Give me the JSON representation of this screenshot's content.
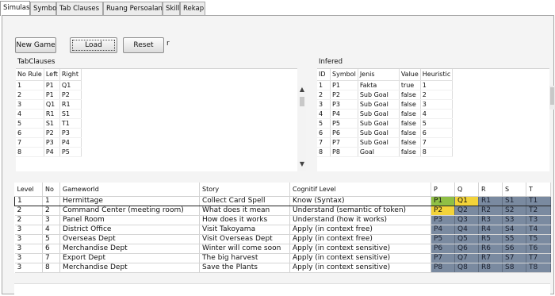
{
  "tabs": [
    {
      "label": "Simulasi",
      "active": true
    },
    {
      "label": "Symbol",
      "active": false
    },
    {
      "label": "Tab Clauses",
      "active": false
    },
    {
      "label": "Ruang Persoalan",
      "active": false
    },
    {
      "label": "Skill",
      "active": false
    },
    {
      "label": "Rekap",
      "active": false
    }
  ],
  "toolbar": {
    "new_game": "New Game",
    "load": "Load",
    "reset": "Reset",
    "stray_text": "r"
  },
  "tab_clauses": {
    "title": "TabClauses",
    "headers": [
      "No Rule",
      "Left",
      "Right"
    ],
    "rows": [
      [
        "1",
        "P1",
        "Q1"
      ],
      [
        "2",
        "P1",
        "P2"
      ],
      [
        "3",
        "Q1",
        "R1"
      ],
      [
        "4",
        "R1",
        "S1"
      ],
      [
        "5",
        "S1",
        "T1"
      ],
      [
        "6",
        "P2",
        "P3"
      ],
      [
        "7",
        "P3",
        "P4"
      ],
      [
        "8",
        "P4",
        "P5"
      ]
    ]
  },
  "infered": {
    "title": "Infered",
    "headers": [
      "ID",
      "Symbol",
      "Jenis",
      "Value",
      "Heuristic"
    ],
    "rows": [
      [
        "1",
        "P1",
        "Fakta",
        "true",
        "1"
      ],
      [
        "2",
        "P2",
        "Sub Goal",
        "false",
        "2"
      ],
      [
        "3",
        "P3",
        "Sub Goal",
        "false",
        "3"
      ],
      [
        "4",
        "P4",
        "Sub Goal",
        "false",
        "4"
      ],
      [
        "5",
        "P5",
        "Sub Goal",
        "false",
        "5"
      ],
      [
        "6",
        "P6",
        "Sub Goal",
        "false",
        "6"
      ],
      [
        "7",
        "P7",
        "Sub Goal",
        "false",
        "7"
      ],
      [
        "8",
        "P8",
        "Goal",
        "false",
        "8"
      ]
    ]
  },
  "main_table": {
    "headers": [
      "Level",
      "No",
      "Gameworld",
      "Story",
      "Cognitif Level",
      "P",
      "Q",
      "R",
      "S",
      "T"
    ],
    "rows": [
      [
        "1",
        "1",
        "Hermittage",
        "Collect Card Spell",
        "Know (Syntax)",
        "P1",
        "Q1",
        "R1",
        "S1",
        "T1"
      ],
      [
        "2",
        "2",
        "Command Center (meeting room)",
        "What does it mean",
        "Understand (semantic of token)",
        "P2",
        "Q2",
        "R2",
        "S2",
        "T2"
      ],
      [
        "2",
        "3",
        "Panel Room",
        "How does it works",
        "Understand (how it works)",
        "P3",
        "Q3",
        "R3",
        "S3",
        "T3"
      ],
      [
        "3",
        "4",
        "District Office",
        "Visit Takoyama",
        "Apply (in context free)",
        "P4",
        "Q4",
        "R4",
        "S4",
        "T4"
      ],
      [
        "3",
        "5",
        "Overseas Dept",
        "Visit Overseas Dept",
        "Apply (in context free)",
        "P5",
        "Q5",
        "R5",
        "S5",
        "T5"
      ],
      [
        "3",
        "6",
        "Merchandise Dept",
        "Winter will come soon",
        "Apply (in context sensitive)",
        "P6",
        "Q6",
        "R6",
        "S6",
        "T6"
      ],
      [
        "3",
        "7",
        "Export Dept",
        "The big harvest",
        "Apply (in context sensitive)",
        "P7",
        "Q7",
        "R7",
        "S7",
        "T7"
      ],
      [
        "3",
        "8",
        "Merchandise Dept",
        "Save the Plants",
        "Apply (in context sensitive)",
        "P8",
        "Q8",
        "R8",
        "S8",
        "T8"
      ]
    ]
  },
  "colors": {
    "cell_green": "#8fbf45",
    "cell_yellow": "#f2d33a",
    "cell_slate": "#7a8aa0",
    "cell_slate_text": "#1c2230"
  },
  "icons": {
    "scroll_up": "triangle-up",
    "scroll_down": "triangle-down"
  }
}
